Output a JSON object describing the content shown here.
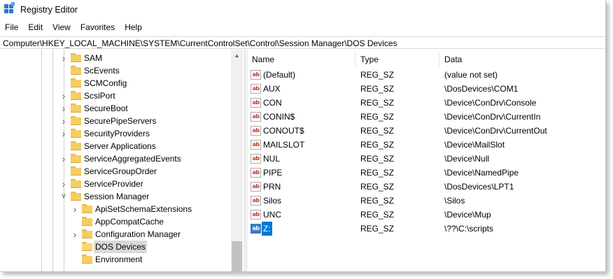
{
  "window": {
    "title": "Registry Editor"
  },
  "menu": [
    "File",
    "Edit",
    "View",
    "Favorites",
    "Help"
  ],
  "address": "Computer\\HKEY_LOCAL_MACHINE\\SYSTEM\\CurrentControlSet\\Control\\Session Manager\\DOS Devices",
  "tree": {
    "items": [
      {
        "label": "SAM",
        "level": 0,
        "expander": "collapsed"
      },
      {
        "label": "ScEvents",
        "level": 0,
        "expander": "none"
      },
      {
        "label": "SCMConfig",
        "level": 0,
        "expander": "none"
      },
      {
        "label": "ScsiPort",
        "level": 0,
        "expander": "collapsed"
      },
      {
        "label": "SecureBoot",
        "level": 0,
        "expander": "collapsed"
      },
      {
        "label": "SecurePipeServers",
        "level": 0,
        "expander": "collapsed"
      },
      {
        "label": "SecurityProviders",
        "level": 0,
        "expander": "collapsed"
      },
      {
        "label": "Server Applications",
        "level": 0,
        "expander": "none"
      },
      {
        "label": "ServiceAggregatedEvents",
        "level": 0,
        "expander": "collapsed"
      },
      {
        "label": "ServiceGroupOrder",
        "level": 0,
        "expander": "none"
      },
      {
        "label": "ServiceProvider",
        "level": 0,
        "expander": "collapsed"
      },
      {
        "label": "Session Manager",
        "level": 0,
        "expander": "expanded"
      },
      {
        "label": "ApiSetSchemaExtensions",
        "level": 1,
        "expander": "collapsed"
      },
      {
        "label": "AppCompatCache",
        "level": 1,
        "expander": "none"
      },
      {
        "label": "Configuration Manager",
        "level": 1,
        "expander": "collapsed"
      },
      {
        "label": "DOS Devices",
        "level": 1,
        "expander": "none",
        "selected": true
      },
      {
        "label": "Environment",
        "level": 1,
        "expander": "none"
      }
    ]
  },
  "list": {
    "columns": {
      "name": "Name",
      "type": "Type",
      "data": "Data"
    },
    "icon_text": "ab",
    "rows": [
      {
        "name": "(Default)",
        "type": "REG_SZ",
        "data": "(value not set)"
      },
      {
        "name": "AUX",
        "type": "REG_SZ",
        "data": "\\DosDevices\\COM1"
      },
      {
        "name": "CON",
        "type": "REG_SZ",
        "data": "\\Device\\ConDrv\\Console"
      },
      {
        "name": "CONIN$",
        "type": "REG_SZ",
        "data": "\\Device\\ConDrv\\CurrentIn"
      },
      {
        "name": "CONOUT$",
        "type": "REG_SZ",
        "data": "\\Device\\ConDrv\\CurrentOut"
      },
      {
        "name": "MAILSLOT",
        "type": "REG_SZ",
        "data": "\\Device\\MailSlot"
      },
      {
        "name": "NUL",
        "type": "REG_SZ",
        "data": "\\Device\\Null"
      },
      {
        "name": "PIPE",
        "type": "REG_SZ",
        "data": "\\Device\\NamedPipe"
      },
      {
        "name": "PRN",
        "type": "REG_SZ",
        "data": "\\DosDevices\\LPT1"
      },
      {
        "name": "Silos",
        "type": "REG_SZ",
        "data": "\\Silos"
      },
      {
        "name": "UNC",
        "type": "REG_SZ",
        "data": "\\Device\\Mup"
      },
      {
        "name": "Z:",
        "type": "REG_SZ",
        "data": "\\??\\C:\\scripts",
        "selected": true
      }
    ]
  },
  "colors": {
    "selection": "#0078d7",
    "folder": "#f5cd61",
    "icon_text": "#c0392b"
  }
}
